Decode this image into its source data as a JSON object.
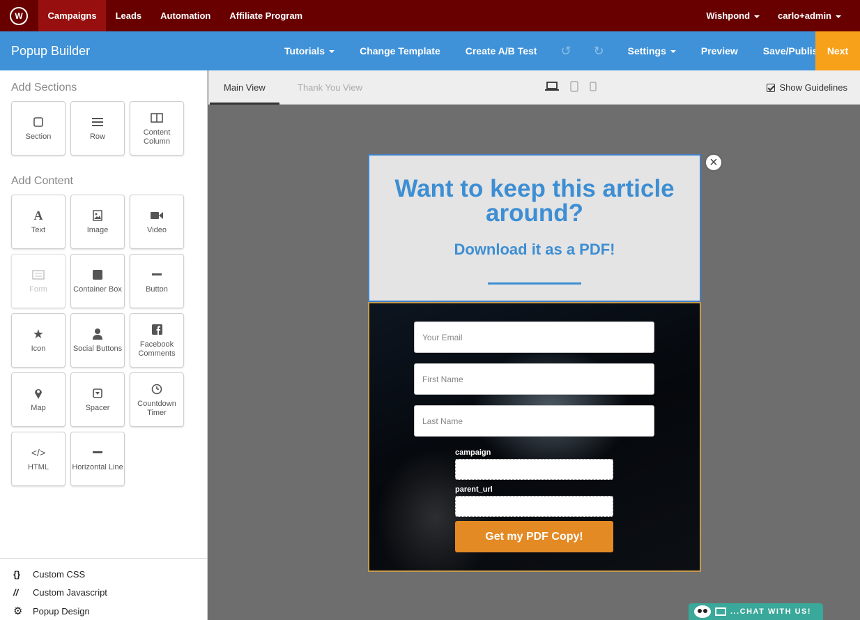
{
  "topnav": {
    "logo": "W",
    "items": [
      {
        "label": "Campaigns"
      },
      {
        "label": "Leads"
      },
      {
        "label": "Automation"
      },
      {
        "label": "Affiliate Program"
      }
    ],
    "account": "Wishpond",
    "user": "carlo+admin",
    "active_color": "#980f0f",
    "bar_color": "#690000"
  },
  "builder": {
    "title": "Popup Builder",
    "tutorials": "Tutorials",
    "change_template": "Change Template",
    "ab_test": "Create A/B Test",
    "undo_icon": "undo-icon",
    "redo_icon": "redo-icon",
    "settings": "Settings",
    "preview": "Preview",
    "save_publish": "Save/Publish",
    "next": "Next",
    "bar_color": "#3f92d8",
    "next_color": "#f7a11a"
  },
  "sidebar": {
    "sections_title": "Add Sections",
    "sections": [
      {
        "label": "Section",
        "icon": "square-icon"
      },
      {
        "label": "Row",
        "icon": "bars-icon"
      },
      {
        "label": "Content Column",
        "icon": "columns-icon"
      }
    ],
    "content_title": "Add Content",
    "content": [
      {
        "label": "Text",
        "icon": "text-icon",
        "glyph": "A"
      },
      {
        "label": "Image",
        "icon": "image-icon"
      },
      {
        "label": "Video",
        "icon": "video-icon"
      },
      {
        "label": "Form",
        "icon": "form-icon",
        "disabled": true
      },
      {
        "label": "Container Box",
        "icon": "container-icon"
      },
      {
        "label": "Button",
        "icon": "button-icon"
      },
      {
        "label": "Icon",
        "icon": "star-icon",
        "glyph": "★"
      },
      {
        "label": "Social Buttons",
        "icon": "person-icon"
      },
      {
        "label": "Facebook Comments",
        "icon": "facebook-icon"
      },
      {
        "label": "Map",
        "icon": "map-pin-icon"
      },
      {
        "label": "Spacer",
        "icon": "spacer-icon"
      },
      {
        "label": "Countdown Timer",
        "icon": "clock-icon"
      },
      {
        "label": "HTML",
        "icon": "code-icon",
        "glyph": "</>"
      },
      {
        "label": "Horizontal Line",
        "icon": "hline-icon"
      }
    ],
    "footer": [
      {
        "label": "Custom CSS",
        "glyph": "{}",
        "icon": "braces-icon"
      },
      {
        "label": "Custom Javascript",
        "glyph": "//",
        "icon": "slashes-icon"
      },
      {
        "label": "Popup Design",
        "glyph": "⚙",
        "icon": "gear-icon"
      }
    ]
  },
  "viewbar": {
    "main_view": "Main View",
    "thank_you_view": "Thank You View",
    "show_guidelines": "Show Guidelines",
    "devices": [
      "desktop-icon",
      "tablet-icon",
      "mobile-icon"
    ]
  },
  "popup": {
    "heading": "Want to keep this article around?",
    "subheading": "Download it as a PDF!",
    "email_placeholder": "Your Email",
    "first_name_placeholder": "First Name",
    "last_name_placeholder": "Last Name",
    "campaign_label": "campaign",
    "parent_url_label": "parent_url",
    "cta": "Get my PDF Copy!",
    "heading_color": "#3d8ed3",
    "cta_color": "#e48a24"
  },
  "chat": {
    "label": "...CHAT WITH US!"
  }
}
